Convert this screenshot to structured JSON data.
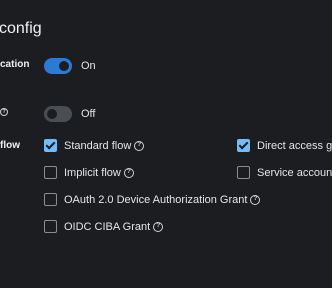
{
  "section": {
    "title": "config"
  },
  "rows": {
    "client_authentication": {
      "label": "cation",
      "state_label": "On",
      "enabled": true
    },
    "authorization": {
      "state_label": "Off",
      "enabled": false
    },
    "auth_flow": {
      "label": "flow"
    }
  },
  "flows": {
    "standard": {
      "label": "Standard flow",
      "checked": true
    },
    "direct_access": {
      "label": "Direct access gr",
      "checked": true
    },
    "implicit": {
      "label": "Implicit flow",
      "checked": false
    },
    "service_accounts": {
      "label": "Service account",
      "checked": false
    },
    "device_grant": {
      "label": "OAuth 2.0 Device Authorization Grant",
      "checked": false
    },
    "ciba": {
      "label": "OIDC CIBA Grant",
      "checked": false
    }
  },
  "icons": {
    "help": "?"
  },
  "colors": {
    "background": "#1b1d21",
    "toggle_on": "#2b7bd6",
    "checkbox_checked": "#73bcf7"
  }
}
